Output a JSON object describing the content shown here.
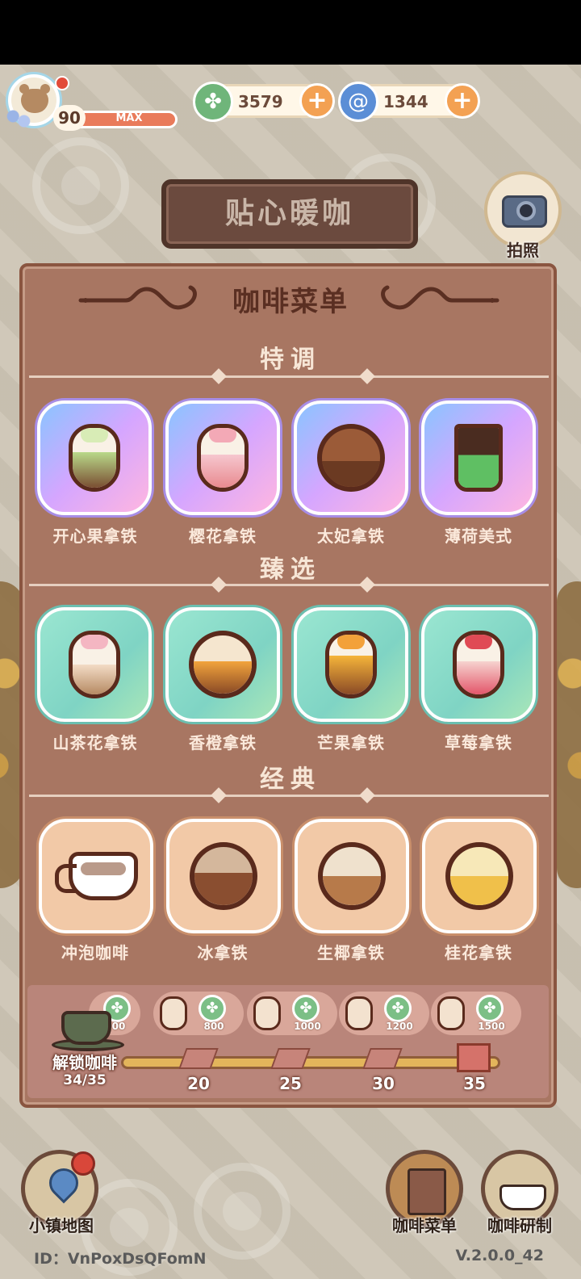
{
  "hud": {
    "level": "90",
    "level_max": "MAX",
    "currency_leaf": "3579",
    "currency_swirl": "1344"
  },
  "cafe_name": "贴心暖咖",
  "camera_label": "拍照",
  "menu": {
    "title": "咖啡菜单",
    "sections": [
      {
        "title": "特调",
        "items": [
          {
            "label": "开心果拿铁"
          },
          {
            "label": "樱花拿铁"
          },
          {
            "label": "太妃拿铁"
          },
          {
            "label": "薄荷美式"
          }
        ]
      },
      {
        "title": "臻选",
        "items": [
          {
            "label": "山茶花拿铁"
          },
          {
            "label": "香橙拿铁"
          },
          {
            "label": "芒果拿铁"
          },
          {
            "label": "草莓拿铁"
          }
        ]
      },
      {
        "title": "经典",
        "items": [
          {
            "label": "冲泡咖啡"
          },
          {
            "label": "冰拿铁"
          },
          {
            "label": "生椰拿铁"
          },
          {
            "label": "桂花拿铁"
          }
        ]
      }
    ]
  },
  "unlock": {
    "label": "解锁咖啡",
    "count": "34/35",
    "progress_fraction": 0.97,
    "rewards": [
      {
        "amount": "00"
      },
      {
        "amount": "800"
      },
      {
        "amount": "1000"
      },
      {
        "amount": "1200"
      },
      {
        "amount": "1500"
      }
    ],
    "milestones": [
      "20",
      "25",
      "30",
      "35"
    ]
  },
  "nav": {
    "map": "小镇地图",
    "menu": "咖啡菜单",
    "brew": "咖啡研制"
  },
  "footer": {
    "id": "ID：VnPoxDsQFomN",
    "version": "V.2.0.0_42"
  },
  "colors": {
    "panel": "#a87662",
    "panel_border": "#8a5540",
    "title_text": "#5a2f22",
    "accent_orange": "#f3a153"
  },
  "icons": {
    "leaf_currency": "leaf-icon",
    "swirl_currency": "swirl-icon",
    "camera": "camera-icon",
    "map": "map-pin-icon",
    "menu": "book-icon",
    "brew": "coffee-cup-icon",
    "gift": "gift-icon"
  }
}
